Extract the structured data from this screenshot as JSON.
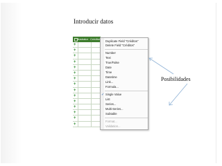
{
  "slide": {
    "title": "Introducir datos",
    "annotation": "Posibilidades"
  },
  "sheet": {
    "header": {
      "col1": "Illustrator",
      "col2": "Créditos"
    },
    "row_count": 15
  },
  "context_menu": {
    "duplicate": "Duplicate Field \"Créditos\"",
    "delete": "Delete Field \"Créditos\"",
    "number": "Number",
    "text": "Text",
    "truefalse": "True/False",
    "date": "Date",
    "time": "Time",
    "datetime": "Datetime",
    "link": "Link...",
    "formula": "Formula...",
    "single_value": "Single Value",
    "list": "List",
    "series": "Series...",
    "multi_series": "Multi-Series...",
    "subtable": "Subtable",
    "format": "Format...",
    "validation": "Validation...",
    "checked_item": "Single Value"
  },
  "colors": {
    "header_green": "#3e7d2e",
    "plus_green": "#2d8a2d",
    "arrow_blue": "#8fb2d6"
  }
}
